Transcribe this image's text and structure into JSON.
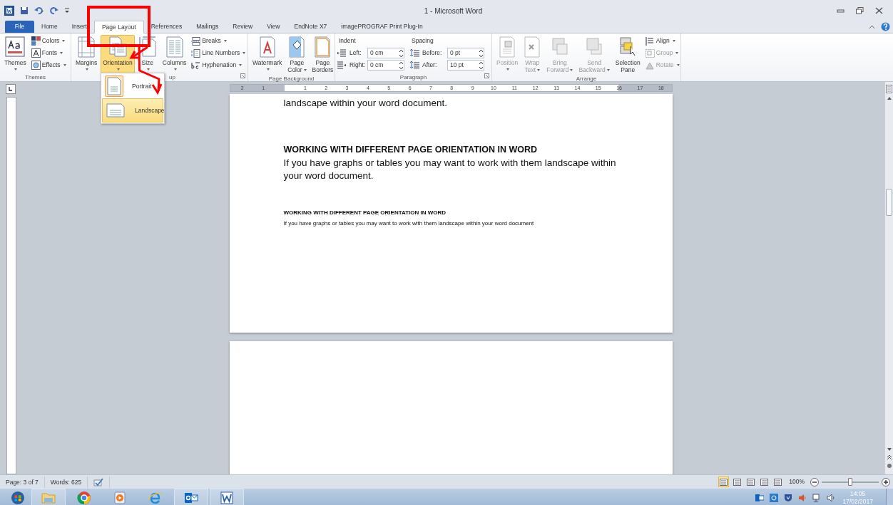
{
  "window": {
    "title": "1 - Microsoft Word"
  },
  "tabs": [
    {
      "label": "File",
      "kind": "file",
      "selected": false
    },
    {
      "label": "Home",
      "kind": "tab",
      "selected": false
    },
    {
      "label": "Insert",
      "kind": "tab",
      "selected": false
    },
    {
      "label": "Page Layout",
      "kind": "tab",
      "selected": true
    },
    {
      "label": "References",
      "kind": "tab",
      "selected": false
    },
    {
      "label": "Mailings",
      "kind": "tab",
      "selected": false
    },
    {
      "label": "Review",
      "kind": "tab",
      "selected": false
    },
    {
      "label": "View",
      "kind": "tab",
      "selected": false
    },
    {
      "label": "EndNote X7",
      "kind": "tab",
      "selected": false
    },
    {
      "label": "imagePROGRAF Print Plug-In",
      "kind": "tab",
      "selected": false
    }
  ],
  "ribbon": {
    "groups": [
      {
        "label": "Themes",
        "launcher": false,
        "items": [
          {
            "kind": "large",
            "lines": [
              "Themes"
            ],
            "dropdown": true
          },
          {
            "kind": "small",
            "label": "Colors",
            "dropdown": true
          },
          {
            "kind": "small",
            "label": "Fonts",
            "dropdown": true
          },
          {
            "kind": "small",
            "label": "Effects",
            "dropdown": true
          }
        ]
      },
      {
        "label": "up",
        "launcher": true,
        "items": [
          {
            "kind": "large",
            "lines": [
              "Margins"
            ],
            "dropdown": true,
            "pressed": false
          },
          {
            "kind": "large",
            "lines": [
              "Orientation"
            ],
            "dropdown": true,
            "pressed": true
          },
          {
            "kind": "large",
            "lines": [
              "Size"
            ],
            "dropdown": true,
            "pressed": false
          },
          {
            "kind": "large",
            "lines": [
              "Columns"
            ],
            "dropdown": true,
            "pressed": false
          },
          {
            "kind": "small",
            "label": "Breaks",
            "dropdown": true,
            "pressed": false
          },
          {
            "kind": "small",
            "label": "Line Numbers",
            "dropdown": true,
            "pressed": false
          },
          {
            "kind": "small",
            "label": "Hyphenation",
            "dropdown": true,
            "pressed": false
          }
        ]
      },
      {
        "label": "Page Background",
        "launcher": false,
        "items": [
          {
            "kind": "large",
            "lines": [
              "Watermark"
            ],
            "dropdown": true
          },
          {
            "kind": "large",
            "lines": [
              "Page",
              "Color"
            ],
            "dropdown": true
          },
          {
            "kind": "large",
            "lines": [
              "Page",
              "Borders"
            ],
            "dropdown": false
          }
        ]
      },
      {
        "label": "Paragraph",
        "launcher": true,
        "items": [
          {
            "kind": "heading",
            "label": "Indent"
          },
          {
            "kind": "spin",
            "label": "Left:",
            "value": "0 cm"
          },
          {
            "kind": "spin",
            "label": "Right:",
            "value": "0 cm"
          },
          {
            "kind": "heading",
            "label": "Spacing"
          },
          {
            "kind": "spin",
            "label": "Before:",
            "value": "0 pt"
          },
          {
            "kind": "spin",
            "label": "After:",
            "value": "10 pt"
          }
        ]
      },
      {
        "label": "Arrange",
        "launcher": false,
        "items": [
          {
            "kind": "large",
            "lines": [
              "Position"
            ],
            "dropdown": true,
            "disabled": true
          },
          {
            "kind": "large",
            "lines": [
              "Wrap",
              "Text"
            ],
            "dropdown": true,
            "disabled": true
          },
          {
            "kind": "large",
            "lines": [
              "Bring",
              "Forward"
            ],
            "dropdown": true,
            "disabled": true
          },
          {
            "kind": "large",
            "lines": [
              "Send",
              "Backward"
            ],
            "dropdown": true,
            "disabled": true
          },
          {
            "kind": "large",
            "lines": [
              "Selection",
              "Pane"
            ],
            "dropdown": false,
            "disabled": false
          },
          {
            "kind": "small",
            "label": "Align",
            "dropdown": true,
            "disabled": false
          },
          {
            "kind": "small",
            "label": "Group",
            "dropdown": true,
            "disabled": true
          },
          {
            "kind": "small",
            "label": "Rotate",
            "dropdown": true,
            "disabled": true
          }
        ]
      }
    ]
  },
  "orientation_menu": {
    "items": [
      {
        "label": "Portrait",
        "checked": true,
        "highlighted": false
      },
      {
        "label": "Landscape",
        "checked": false,
        "highlighted": true
      }
    ]
  },
  "ruler": {
    "labels": [
      "2",
      "1",
      "1",
      "2",
      "3",
      "4",
      "5",
      "6",
      "7",
      "8",
      "9",
      "10",
      "11",
      "12",
      "13",
      "14",
      "15",
      "16",
      "17",
      "18"
    ]
  },
  "document": {
    "blocks": [
      {
        "kind": "para",
        "text": "landscape within your word document."
      },
      {
        "kind": "heading",
        "text": "WORKING WITH DIFFERENT PAGE ORIENTATION IN WORD"
      },
      {
        "kind": "para",
        "text": "If you have graphs or tables you may want to work with them landscape within your word document."
      },
      {
        "kind": "small_heading",
        "text": "WORKING WITH DIFFERENT  PAGE ORIENTATION IN WORD"
      },
      {
        "kind": "small_para",
        "text": "If you have graphs or tables you may want to work with them landscape within  your word document"
      }
    ]
  },
  "status_bar": {
    "page": "Page: 3 of 7",
    "words": "Words: 625",
    "views": [
      {
        "selected": true
      },
      {
        "selected": false
      },
      {
        "selected": false
      },
      {
        "selected": false
      },
      {
        "selected": false
      }
    ],
    "zoom": "100%",
    "zoom_level": {
      "level": 0.5
    }
  },
  "taskbar": {
    "apps": [
      {
        "running": true
      },
      {
        "running": false
      },
      {
        "running": false
      },
      {
        "running": false
      },
      {
        "running": true
      },
      {
        "running": true
      }
    ],
    "time": "14:05",
    "date": "17/02/2017"
  }
}
